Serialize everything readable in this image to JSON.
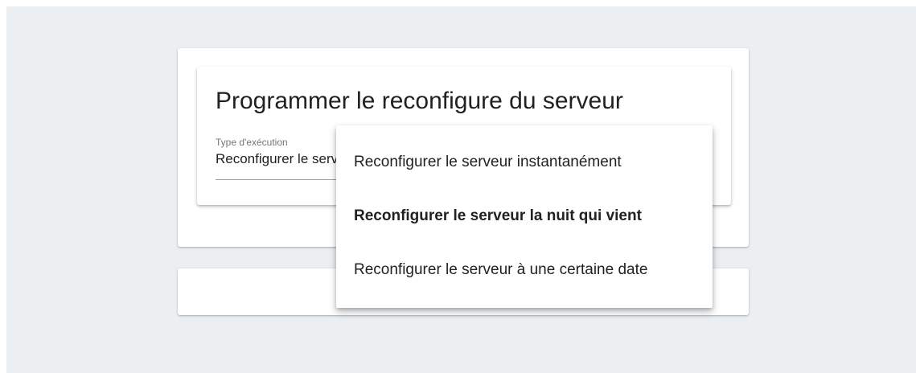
{
  "form": {
    "title": "Programmer le reconfigure du serveur",
    "field_label": "Type d'exécution",
    "field_value": "Reconfigurer le serveur la nuit qui vient"
  },
  "menu": {
    "items": [
      {
        "label": "Reconfigurer le serveur instantanément",
        "selected": false
      },
      {
        "label": "Reconfigurer le serveur la nuit qui vient",
        "selected": true
      },
      {
        "label": "Reconfigurer le serveur à une certaine date",
        "selected": false
      }
    ]
  }
}
